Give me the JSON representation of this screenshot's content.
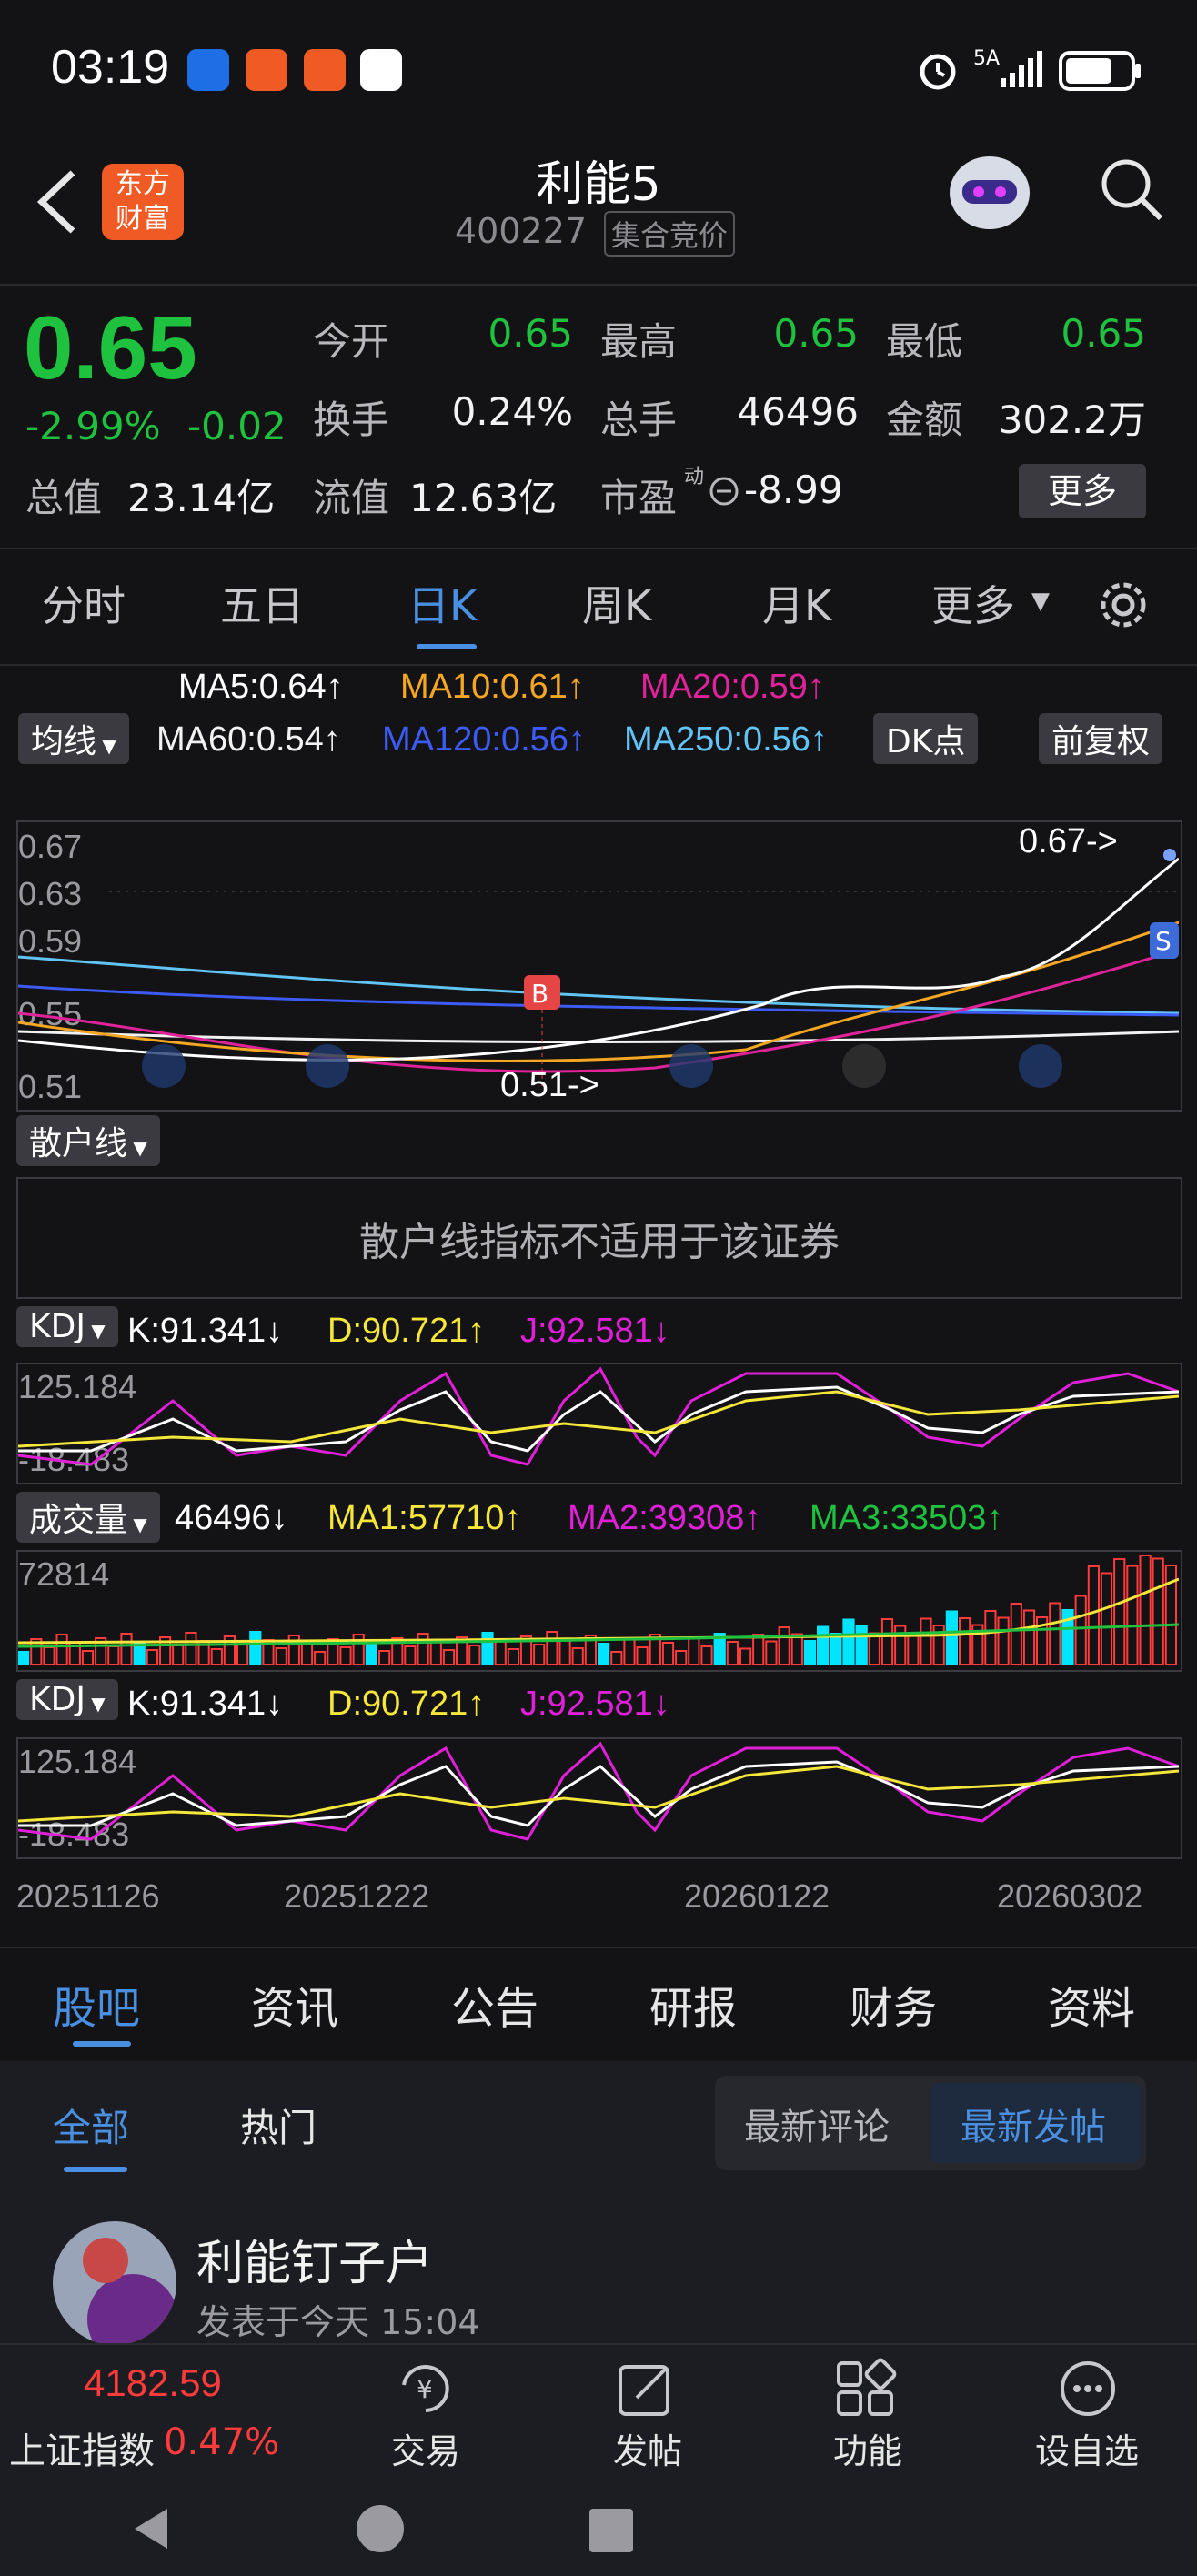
{
  "status_bar": {
    "time": "03:19",
    "network": "5A",
    "icons": [
      "shield-app-icon",
      "guba-app-icon",
      "plane-app-icon",
      "chat-app-icon",
      "alarm-icon",
      "signal-icon",
      "battery-icon"
    ]
  },
  "header": {
    "brand_line1": "东方",
    "brand_line2": "财富",
    "stock_name": "利能5",
    "stock_code": "400227",
    "auction_tag": "集合竞价"
  },
  "quote": {
    "price": "0.65",
    "change_pct": "-2.99%",
    "change": "-0.02",
    "open_label": "今开",
    "open": "0.65",
    "high_label": "最高",
    "high": "0.65",
    "low_label": "最低",
    "low": "0.65",
    "turnover_label": "换手",
    "turnover": "0.24%",
    "volume_label": "总手",
    "volume": "46496",
    "amount_label": "金额",
    "amount": "302.2万",
    "mktcap_label": "总值",
    "mktcap": "23.14亿",
    "float_label": "流值",
    "float": "12.63亿",
    "pe_label": "市盈",
    "pe_sup": "动",
    "pe": "-8.99",
    "more_button": "更多"
  },
  "chart_tabs": {
    "items": [
      "分时",
      "五日",
      "日K",
      "周K",
      "月K",
      "更多"
    ],
    "active_index": 2
  },
  "ma": {
    "ma5": "MA5:0.64↑",
    "ma10": "MA10:0.61↑",
    "ma20": "MA20:0.59↑",
    "ma60": "MA60:0.54↑",
    "ma120": "MA120:0.56↑",
    "ma250": "MA250:0.56↑",
    "selector": "均线",
    "dk_button": "DK点",
    "adjust_button": "前复权"
  },
  "price_axis": [
    "0.67",
    "0.63",
    "0.59",
    "0.55",
    "0.51"
  ],
  "price_annotations": {
    "high_marker": "0.67->",
    "low_marker": "0.51->",
    "buy_tag": "B",
    "sell_tag": "S"
  },
  "retail": {
    "selector": "散户线",
    "message": "散户线指标不适用于该证券"
  },
  "kdj1": {
    "selector": "KDJ",
    "k": "K:91.341↓",
    "d": "D:90.721↑",
    "j": "J:92.581↓",
    "axis_top": "125.184",
    "axis_bottom": "-18.483"
  },
  "volume": {
    "selector": "成交量",
    "value": "46496↓",
    "ma1": "MA1:57710↑",
    "ma2": "MA2:39308↑",
    "ma3": "MA3:33503↑",
    "axis_top": "72814"
  },
  "kdj2": {
    "selector": "KDJ",
    "k": "K:91.341↓",
    "d": "D:90.721↑",
    "j": "J:92.581↓",
    "axis_top": "125.184",
    "axis_bottom": "-18.483"
  },
  "dates": [
    "20251126",
    "20251222",
    "20260122",
    "20260302"
  ],
  "bottom_tabs": {
    "items": [
      "股吧",
      "资讯",
      "公告",
      "研报",
      "财务",
      "资料"
    ],
    "active_index": 0
  },
  "filters": {
    "all": "全部",
    "hot": "热门",
    "latest_comment": "最新评论",
    "latest_post": "最新发帖"
  },
  "post": {
    "author": "利能钉子户",
    "time": "发表于今天 15:04"
  },
  "bottom_nav": {
    "index_value": "4182.59",
    "index_name": "上证指数",
    "index_change": "0.47%",
    "trade": "交易",
    "post": "发帖",
    "functions": "功能",
    "watchlist": "设自选"
  },
  "colors": {
    "up_red": "#ff3b3b",
    "down_green": "#1fc23f",
    "accent_blue": "#4a90e2",
    "ma10": "#f5a623",
    "ma20": "#e0239b",
    "k_line": "#ffffff",
    "d_line": "#f5e63a",
    "j_line": "#e020d8",
    "volume_cyan": "#00e5ff"
  }
}
